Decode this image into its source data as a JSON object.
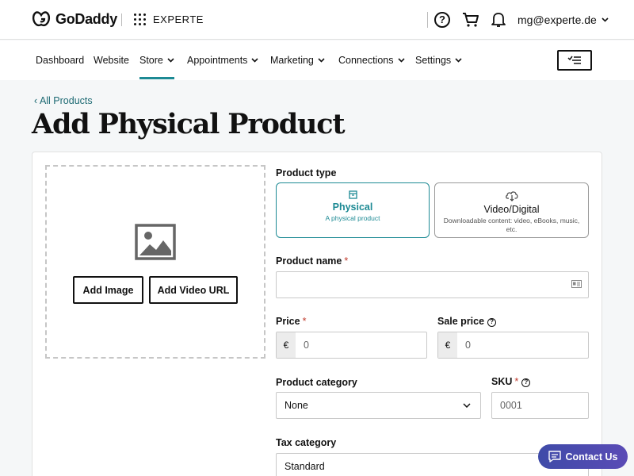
{
  "header": {
    "logo_text": "GoDaddy",
    "brand": "EXPERTE",
    "user_email": "mg@experte.de",
    "help_glyph": "?"
  },
  "nav": {
    "items": [
      {
        "label": "Dashboard"
      },
      {
        "label": "Website"
      },
      {
        "label": "Store"
      },
      {
        "label": "Appointments"
      },
      {
        "label": "Marketing"
      },
      {
        "label": "Connections"
      },
      {
        "label": "Settings"
      }
    ],
    "active": "Store"
  },
  "page": {
    "back_link": "‹ All Products",
    "title": "Add Physical Product"
  },
  "media": {
    "add_image": "Add Image",
    "add_video_url": "Add Video URL"
  },
  "product_type": {
    "label": "Product type",
    "options": [
      {
        "title": "Physical",
        "desc": "A physical product",
        "selected": true
      },
      {
        "title": "Video/Digital",
        "desc": "Downloadable content: video, eBooks, music, etc.",
        "selected": false
      }
    ]
  },
  "form": {
    "product_name_label": "Product name",
    "product_name_value": "",
    "required_mark": "*",
    "price_label": "Price",
    "price_currency": "€",
    "price_placeholder": "0",
    "sale_price_label": "Sale price",
    "sale_currency": "€",
    "sale_placeholder": "0",
    "category_label": "Product category",
    "category_value": "None",
    "sku_label": "SKU",
    "sku_placeholder": "0001",
    "tax_label": "Tax category",
    "tax_value": "Standard"
  },
  "contact": {
    "label": "Contact Us"
  },
  "colors": {
    "accent": "#1d8a94",
    "required": "#c0392b",
    "contact_bg": "#3f4ba8"
  }
}
